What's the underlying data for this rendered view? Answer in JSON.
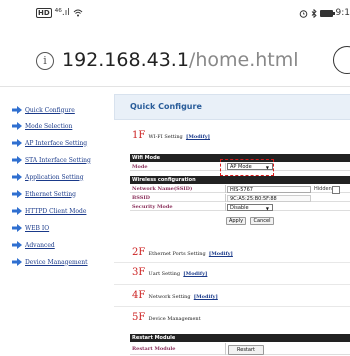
{
  "status_bar": {
    "hd": "HD",
    "signal": "⁴⁶.ıl",
    "time": "9:1"
  },
  "browser": {
    "url_host": "192.168.43.1",
    "url_path": "/home.html"
  },
  "sidebar": {
    "items": [
      {
        "label": "Quick Configure"
      },
      {
        "label": "Mode Selection"
      },
      {
        "label": "AP Interface Setting"
      },
      {
        "label": "STA Interface Setting"
      },
      {
        "label": "Application Setting"
      },
      {
        "label": "Ethernet Setting"
      },
      {
        "label": "HTTPD Client Mode"
      },
      {
        "label": "WEB IO"
      },
      {
        "label": "Advanced"
      },
      {
        "label": "Device Management"
      }
    ]
  },
  "main": {
    "title": "Quick Configure",
    "modify_label": "[Modify]",
    "sections": [
      {
        "num": "1F",
        "text": "WI-FI Setting"
      },
      {
        "num": "2F",
        "text": "Ethernet Ports Setting"
      },
      {
        "num": "3F",
        "text": "Uart Setting"
      },
      {
        "num": "4F",
        "text": "Network Setting"
      },
      {
        "num": "5F",
        "text": "Device Management"
      }
    ],
    "wifi_table": {
      "head1": "Wifi Mode",
      "mode_label": "Mode",
      "mode_value": "AP Mode",
      "head2": "Wireless configuration",
      "ssid_label": "Network Name(SSID)",
      "ssid_value": "HIS-5767",
      "hidden_label": "Hidden",
      "bssid_label": "BSSID",
      "bssid_value": "9C:A5:25:B0:5F:88",
      "security_label": "Security Mode",
      "security_value": "Disable",
      "apply_label": "Apply",
      "cancel_label": "Cancel"
    },
    "restart_table": {
      "head": "Restart Module",
      "row_label": "Restart Module",
      "button_label": "Restart"
    }
  }
}
